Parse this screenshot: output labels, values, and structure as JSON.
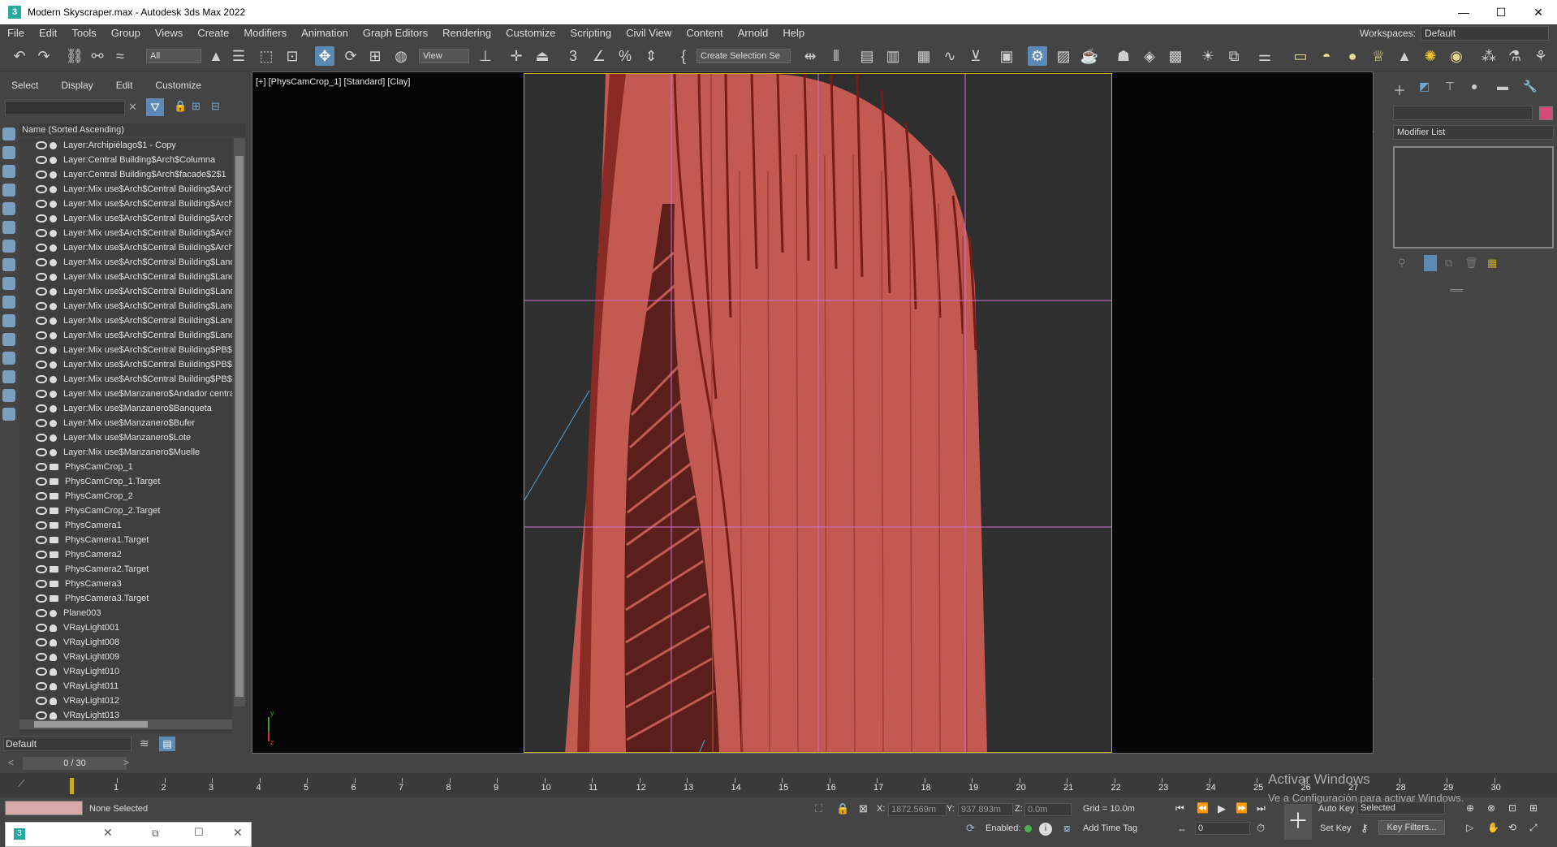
{
  "window": {
    "title": "Modern Skyscraper.max - Autodesk 3ds Max 2022",
    "minimize": "—",
    "maximize": "☐",
    "close": "✕"
  },
  "menu": [
    "File",
    "Edit",
    "Tools",
    "Group",
    "Views",
    "Create",
    "Modifiers",
    "Animation",
    "Graph Editors",
    "Rendering",
    "Customize",
    "Scripting",
    "Civil View",
    "Content",
    "Arnold",
    "Help"
  ],
  "workspace": {
    "label": "Workspaces:",
    "value": "Default"
  },
  "toolbar": {
    "filter_value": "All",
    "view_value": "View",
    "selection_set": "Create Selection Se"
  },
  "explorer": {
    "tabs": [
      "Select",
      "Display",
      "Edit",
      "Customize"
    ],
    "column_header": "Name (Sorted Ascending)",
    "rows": [
      {
        "name": "Layer:Archipiélago$1 - Copy",
        "type": "layer"
      },
      {
        "name": "Layer:Central Building$Arch$Columna",
        "type": "layer"
      },
      {
        "name": "Layer:Central Building$Arch$facade$2$1",
        "type": "layer"
      },
      {
        "name": "Layer:Mix use$Arch$Central Building$Arch$",
        "type": "layer"
      },
      {
        "name": "Layer:Mix use$Arch$Central Building$Arch$",
        "type": "layer"
      },
      {
        "name": "Layer:Mix use$Arch$Central Building$Arch$",
        "type": "layer"
      },
      {
        "name": "Layer:Mix use$Arch$Central Building$Arch$",
        "type": "layer"
      },
      {
        "name": "Layer:Mix use$Arch$Central Building$Arch$",
        "type": "layer"
      },
      {
        "name": "Layer:Mix use$Arch$Central Building$Lands",
        "type": "layer"
      },
      {
        "name": "Layer:Mix use$Arch$Central Building$Lands",
        "type": "layer"
      },
      {
        "name": "Layer:Mix use$Arch$Central Building$Lands",
        "type": "layer"
      },
      {
        "name": "Layer:Mix use$Arch$Central Building$Lands",
        "type": "layer"
      },
      {
        "name": "Layer:Mix use$Arch$Central Building$Lands",
        "type": "layer"
      },
      {
        "name": "Layer:Mix use$Arch$Central Building$Lands",
        "type": "layer"
      },
      {
        "name": "Layer:Mix use$Arch$Central Building$PB$B",
        "type": "layer"
      },
      {
        "name": "Layer:Mix use$Arch$Central Building$PB$gl",
        "type": "layer"
      },
      {
        "name": "Layer:Mix use$Arch$Central Building$PB$Lc",
        "type": "layer"
      },
      {
        "name": "Layer:Mix use$Manzanero$Andador centra",
        "type": "layer"
      },
      {
        "name": "Layer:Mix use$Manzanero$Banqueta",
        "type": "layer"
      },
      {
        "name": "Layer:Mix use$Manzanero$Bufer",
        "type": "layer"
      },
      {
        "name": "Layer:Mix use$Manzanero$Lote",
        "type": "layer"
      },
      {
        "name": "Layer:Mix use$Manzanero$Muelle",
        "type": "layer"
      },
      {
        "name": "PhysCamCrop_1",
        "type": "camera"
      },
      {
        "name": "PhysCamCrop_1.Target",
        "type": "camera"
      },
      {
        "name": "PhysCamCrop_2",
        "type": "camera"
      },
      {
        "name": "PhysCamCrop_2.Target",
        "type": "camera"
      },
      {
        "name": "PhysCamera1",
        "type": "camera"
      },
      {
        "name": "PhysCamera1.Target",
        "type": "camera"
      },
      {
        "name": "PhysCamera2",
        "type": "camera"
      },
      {
        "name": "PhysCamera2.Target",
        "type": "camera"
      },
      {
        "name": "PhysCamera3",
        "type": "camera"
      },
      {
        "name": "PhysCamera3.Target",
        "type": "camera"
      },
      {
        "name": "Plane003",
        "type": "layer"
      },
      {
        "name": "VRayLight001",
        "type": "light"
      },
      {
        "name": "VRayLight008",
        "type": "light"
      },
      {
        "name": "VRayLight009",
        "type": "light"
      },
      {
        "name": "VRayLight010",
        "type": "light"
      },
      {
        "name": "VRayLight011",
        "type": "light"
      },
      {
        "name": "VRayLight012",
        "type": "light"
      },
      {
        "name": "VRayLight013",
        "type": "light"
      }
    ]
  },
  "layer_dropdown": "Default",
  "viewport": {
    "label": "[+] [PhysCamCrop_1] [Standard] [Clay]",
    "axis_y": "y",
    "axis_z": "z"
  },
  "command_panel": {
    "modifier_list": "Modifier List",
    "swatch_color": "#d64a7a"
  },
  "time": {
    "frame": "0 / 30",
    "ticks": [
      "1",
      "2",
      "3",
      "4",
      "5",
      "6",
      "7",
      "8",
      "9",
      "10",
      "11",
      "12",
      "13",
      "14",
      "15",
      "16",
      "17",
      "18",
      "19",
      "20",
      "21",
      "22",
      "23",
      "24",
      "25",
      "26",
      "27",
      "28",
      "29",
      "30"
    ]
  },
  "status": {
    "selection": "None Selected",
    "x_label": "X:",
    "x_value": "1872.569m",
    "y_label": "Y:",
    "y_value": "937.893m",
    "z_label": "Z:",
    "z_value": "0.0m",
    "grid": "Grid = 10.0m",
    "enabled": "Enabled:",
    "add_time_tag": "Add Time Tag",
    "auto_key": "Auto Key",
    "set_key": "Set Key",
    "selected": "Selected",
    "key_filters": "Key Filters...",
    "frame_value": "0",
    "activate_line1": "Activar Windows",
    "activate_line2": "Ve a Configuración para activar Windows."
  }
}
